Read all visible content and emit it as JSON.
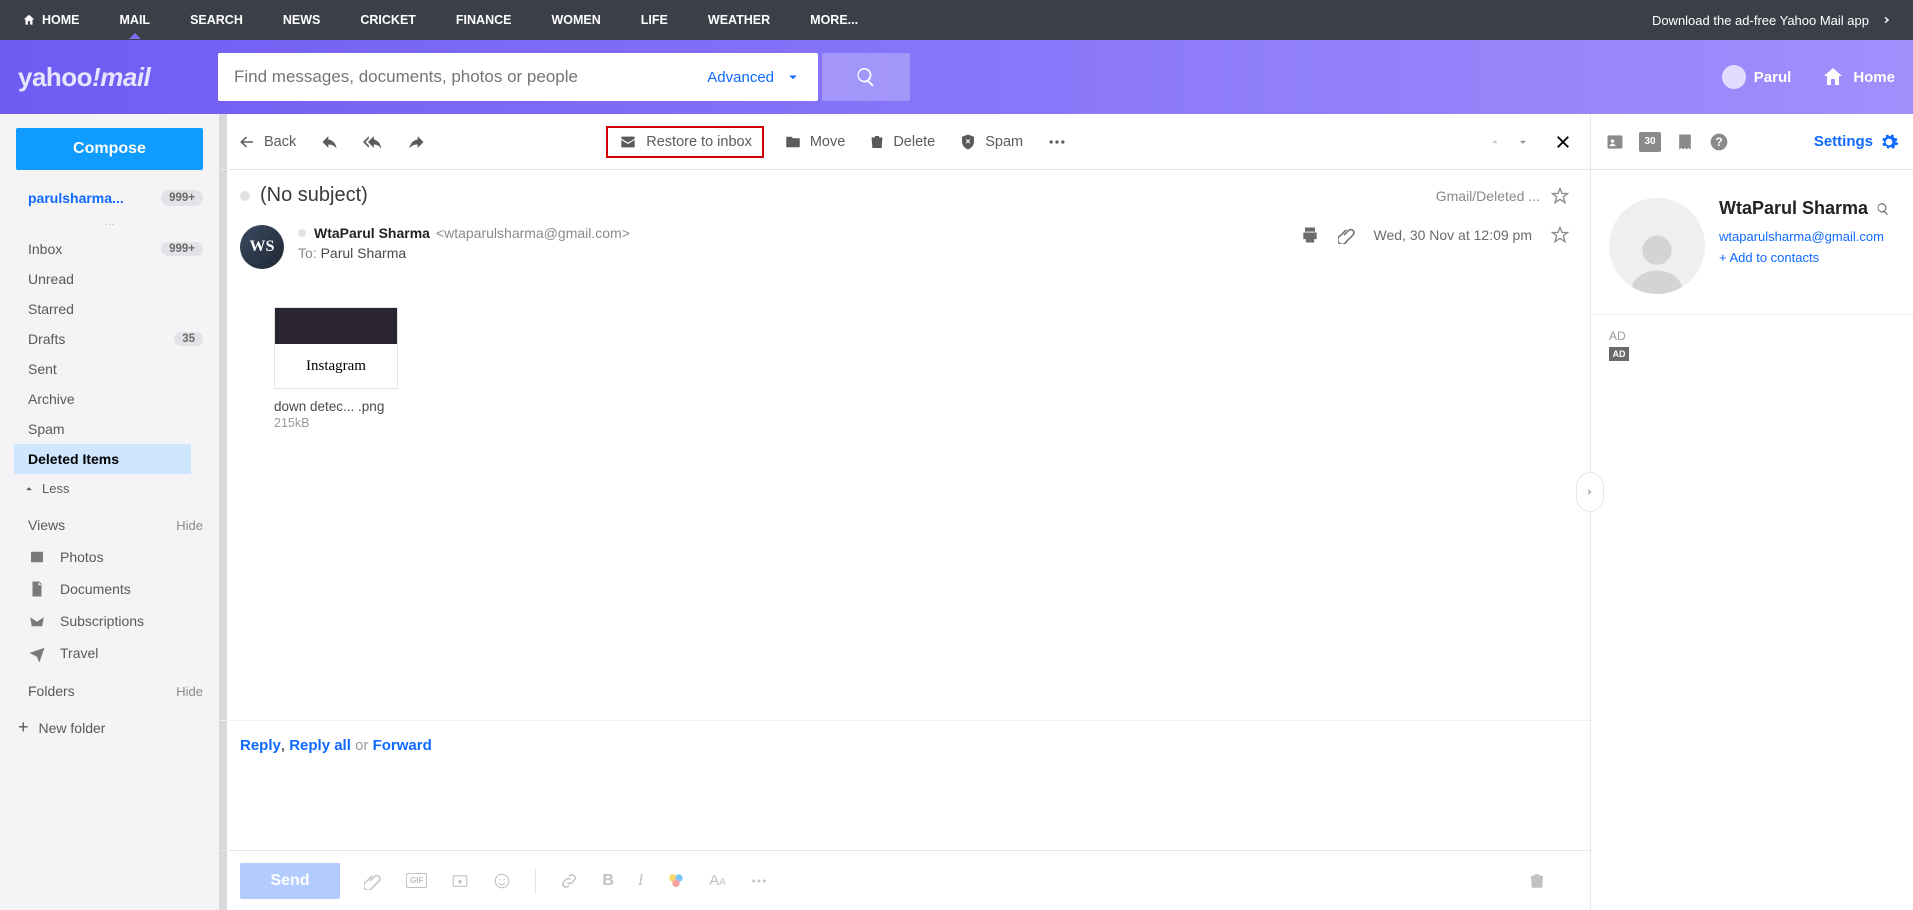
{
  "topnav": {
    "items": [
      "HOME",
      "MAIL",
      "SEARCH",
      "NEWS",
      "CRICKET",
      "FINANCE",
      "WOMEN",
      "LIFE",
      "WEATHER",
      "MORE..."
    ],
    "active_index": 1,
    "right_text": "Download the ad-free Yahoo Mail app"
  },
  "header": {
    "logo_a": "yahoo",
    "logo_b": "!",
    "logo_c": "mail",
    "search_placeholder": "Find messages, documents, photos or people",
    "advanced": "Advanced",
    "user": "Parul",
    "home": "Home"
  },
  "sidebar": {
    "compose": "Compose",
    "account": "parulsharma...",
    "account_badge": "999+",
    "dash": "...",
    "folders": [
      {
        "label": "Inbox",
        "count": "999+"
      },
      {
        "label": "Unread"
      },
      {
        "label": "Starred"
      },
      {
        "label": "Drafts",
        "count": "35"
      },
      {
        "label": "Sent"
      },
      {
        "label": "Archive"
      },
      {
        "label": "Spam"
      },
      {
        "label": "Deleted Items",
        "selected": true
      }
    ],
    "less": "Less",
    "views_header": "Views",
    "hide": "Hide",
    "views": [
      "Photos",
      "Documents",
      "Subscriptions",
      "Travel"
    ],
    "folders_header": "Folders",
    "new_folder": "New folder"
  },
  "toolbar": {
    "back": "Back",
    "restore": "Restore to inbox",
    "move": "Move",
    "delete": "Delete",
    "spam": "Spam"
  },
  "message": {
    "subject": "(No subject)",
    "folder_label": "Gmail/Deleted ...",
    "sender_initials": "WS",
    "sender_name": "WtaParul Sharma",
    "sender_email": "<wtaparulsharma@gmail.com>",
    "to_label": "To:",
    "to_name": "Parul Sharma",
    "date": "Wed, 30 Nov at 12:09 pm",
    "attachment": {
      "thumb_label": "Instagram",
      "name": "down detec... .png",
      "size": "215kB"
    }
  },
  "reply_bar": {
    "reply": "Reply",
    "sep1": ", ",
    "reply_all": "Reply all",
    "or": " or ",
    "forward": "Forward"
  },
  "compose": {
    "send": "Send"
  },
  "right_pane": {
    "settings": "Settings",
    "contact_name": "WtaParul Sharma",
    "contact_email": "wtaparulsharma@gmail.com",
    "add_contacts": "+ Add to contacts",
    "ad_label": "AD",
    "ad_box": "AD",
    "calendar_num": "30"
  }
}
